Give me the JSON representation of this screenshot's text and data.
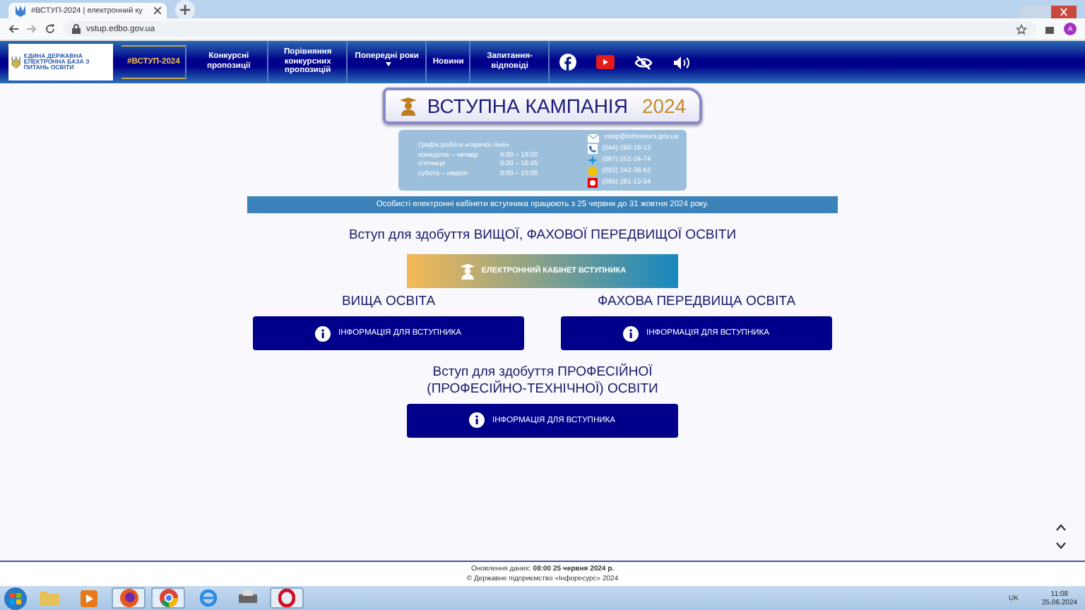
{
  "browser": {
    "tab_title": "#ВСТУП-2024 | електронний ку",
    "url": "vstup.edbo.gov.ua",
    "profile_initial": "A"
  },
  "nav": {
    "logo_text": "ЄДИНА ДЕРЖАВНА ЕЛЕКТРОННА БАЗА З ПИТАНЬ ОСВІТИ",
    "items": [
      {
        "label": "#ВСТУП-2024",
        "selected": true,
        "dropdown": false
      },
      {
        "label": "Конкурсні пропозиції",
        "selected": false,
        "dropdown": false
      },
      {
        "label": "Порівняння конкурсних пропозицій",
        "selected": false,
        "dropdown": false
      },
      {
        "label": "Попередні роки",
        "selected": false,
        "dropdown": true
      },
      {
        "label": "Новини",
        "selected": false,
        "dropdown": false
      },
      {
        "label": "Запитання-відповіді",
        "selected": false,
        "dropdown": false
      }
    ]
  },
  "banner": {
    "title": "ВСТУПНА КАМПАНІЯ",
    "year": "2024"
  },
  "hotline": {
    "heading": "Графік роботи «гарячої лінії»",
    "schedule": [
      {
        "days": "понеділок – четвер",
        "hours": "9:00 – 18:00"
      },
      {
        "days": "п'ятниця",
        "hours": "9:00 – 16:45"
      },
      {
        "days": "субота – неділя",
        "hours": "9:00 – 15:00"
      }
    ],
    "contacts": [
      {
        "kind": "email",
        "text": "vstup@inforesurs.gov.ua"
      },
      {
        "kind": "phone",
        "text": "(044) 290-18-13"
      },
      {
        "kind": "kyivstar",
        "text": "(067) 551-24-74"
      },
      {
        "kind": "lifecell",
        "text": "(093) 342-38-63"
      },
      {
        "kind": "vodafone",
        "text": "(095) 281-13-54"
      }
    ]
  },
  "notice": "Особисті електронні кабінети вступника працюють з 25 червня до 31 жовтня 2024 року.",
  "higher_heading": "Вступ для здобуття ВИЩОЇ, ФАХОВОЇ ПЕРЕДВИЩОЇ ОСВІТИ",
  "cabinet_button": "ЕЛЕКТРОННИЙ КАБІНЕТ ВСТУПНИКА",
  "columns": [
    {
      "heading": "ВИЩА ОСВІТА",
      "button": "ІНФОРМАЦІЯ ДЛЯ ВСТУПНИКА"
    },
    {
      "heading": "ФАХОВА ПЕРЕДВИЩА ОСВІТА",
      "button": "ІНФОРМАЦІЯ ДЛЯ ВСТУПНИКА"
    }
  ],
  "vocational": {
    "heading_line_1": "Вступ для здобуття ПРОФЕСІЙНОЇ",
    "heading_line_2": "(ПРОФЕСІЙНО-ТЕХНІЧНОЇ) ОСВІТИ",
    "button": "ІНФОРМАЦІЯ ДЛЯ ВСТУПНИКА"
  },
  "footer": {
    "updated": "Оновлення даних: **08:00 25 червня 2024 р.**",
    "copyright": "© Державне підприємство «Інфоресурс» 2024"
  },
  "taskbar": {
    "apps": [
      {
        "kind": "folder",
        "selected": false
      },
      {
        "kind": "media",
        "selected": false
      },
      {
        "kind": "firefox",
        "selected": true
      },
      {
        "kind": "chrome",
        "selected": true
      },
      {
        "kind": "ie",
        "selected": false
      },
      {
        "kind": "printer",
        "selected": false
      },
      {
        "kind": "opera",
        "selected": true
      }
    ],
    "language": "UK",
    "time": "11:08",
    "date": "25.06.2024"
  }
}
